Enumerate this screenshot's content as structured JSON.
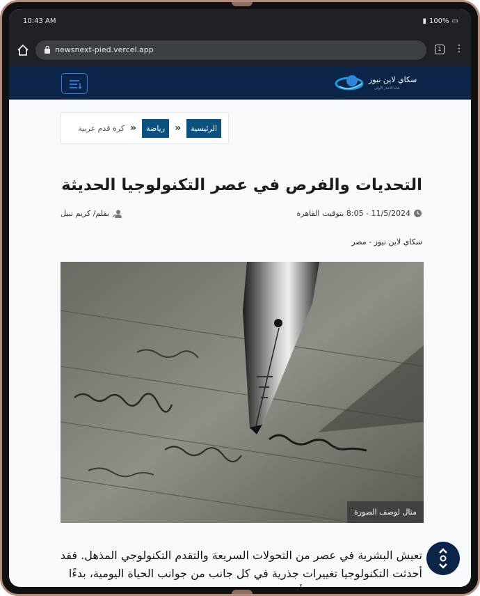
{
  "status": {
    "time": "10:43 AM",
    "battery": "100%"
  },
  "browser": {
    "url": "newsnext-pied.vercel.app",
    "tab_count": "1"
  },
  "site": {
    "logo_title": "سكاي لاين نيوز",
    "logo_sub": "قناة الأخبار الأولى"
  },
  "breadcrumb": {
    "home": "الرئيسية",
    "category": "رياضة",
    "subcategory": "كرة قدم عربية"
  },
  "article": {
    "title": "التحديات والفرص في عصر التكنولوجيا الحديثة",
    "datetime": "11/5/2024 - 8:05 بتوقيت القاهرة",
    "author": "بقلم/ كريم نبيل",
    "source": "سكاي لاين نيوز - مصر",
    "image_caption": "مثال لوصف الصورة",
    "body": "تعيش البشرية في عصر من التحولات السريعة والتقدم التكنولوجي المذهل. فقد أحدثت التكنولوجيا تغييرات جذرية في كل جانب من جوانب الحياة اليومية، بدءًا من طريقة التواصل وحتى أساليب العمل والتعليم."
  },
  "colors": {
    "header_bg": "#0b2447",
    "crumb_bg": "#0b5280",
    "accent": "#3b7be0"
  },
  "icons": [
    "home-icon",
    "lock-icon",
    "tabs-icon",
    "menu-dots-icon",
    "hamburger-icon",
    "clock-icon",
    "user-pen-icon",
    "scroll-arrows-icon"
  ]
}
